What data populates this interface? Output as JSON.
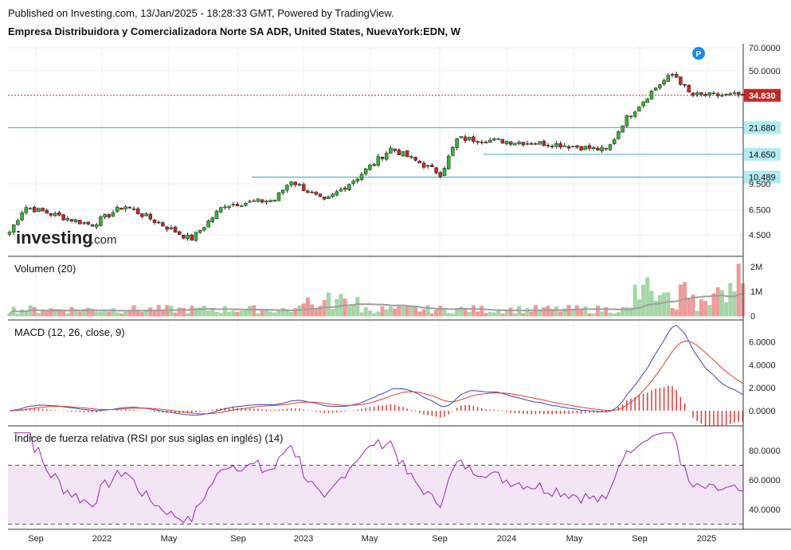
{
  "header": {
    "published": "Published on Investing.com, 13/Jan/2025 - 18:28:33 GMT, Powered by TradingView.",
    "instrument": "Empresa Distribuidora y Comercializadora Norte SA ADR, United States, NuevaYork:EDN, W"
  },
  "logo": {
    "text": "investing",
    "suffix": ".com"
  },
  "colors": {
    "up": "#3ab03a",
    "down": "#c62828",
    "ma": "#9e9e9e",
    "macd": "#3949ab",
    "signal": "#e53935",
    "rsi": "#9c27b0",
    "rsi_band": "#f3e5f5",
    "level": "#4aa3b5",
    "price_line": "#c62828"
  },
  "chart_data": [
    {
      "type": "candlestick",
      "title": "",
      "price_scale": "log",
      "y_ticks": [
        "70.0000",
        "50.0000",
        "21.680",
        "14.650",
        "10.489",
        "9.500",
        "6.500",
        "4.500"
      ],
      "x_ticks": [
        "Sep",
        "2022",
        "May",
        "Sep",
        "2023",
        "May",
        "Sep",
        "2024",
        "May",
        "Sep",
        "2025"
      ],
      "last_price_label": "34.830",
      "levels": [
        {
          "label": "21.680",
          "value": 21.68
        },
        {
          "label": "14.650",
          "value": 14.65
        },
        {
          "label": "10.489",
          "value": 10.489
        }
      ],
      "marker": "P",
      "ohlc_anchors": [
        {
          "date": "2021-08",
          "close": 4.5
        },
        {
          "date": "2021-09",
          "close": 6.8
        },
        {
          "date": "2022-01",
          "close": 5.2
        },
        {
          "date": "2022-03",
          "close": 6.9
        },
        {
          "date": "2022-07",
          "close": 4.2
        },
        {
          "date": "2022-09",
          "close": 7.0
        },
        {
          "date": "2022-12",
          "close": 7.5
        },
        {
          "date": "2023-01",
          "close": 10.0
        },
        {
          "date": "2023-03",
          "close": 7.3
        },
        {
          "date": "2023-05",
          "close": 10.5
        },
        {
          "date": "2023-07",
          "close": 16.0
        },
        {
          "date": "2023-09",
          "close": 12.5
        },
        {
          "date": "2023-10",
          "close": 11.0
        },
        {
          "date": "2023-11",
          "close": 18.5
        },
        {
          "date": "2024-05",
          "close": 17.0
        },
        {
          "date": "2024-08",
          "close": 15.5
        },
        {
          "date": "2024-09",
          "close": 24.0
        },
        {
          "date": "2024-11",
          "close": 40.0
        },
        {
          "date": "2024-12",
          "close": 48.0
        },
        {
          "date": "2025-01",
          "close": 34.83
        }
      ]
    },
    {
      "type": "bar",
      "title": "Volumen (20)",
      "y_ticks": [
        "2M",
        "1M",
        "0"
      ]
    },
    {
      "type": "line",
      "title": "MACD (12, 26, close, 9)",
      "y_ticks": [
        "6.0000",
        "4.0000",
        "2.0000",
        "0.0000"
      ],
      "series": [
        {
          "values_peak": 6.8
        },
        {
          "values_peak": 5.9
        }
      ]
    },
    {
      "type": "line",
      "title": "Índice de fuerza relativa (RSI por sus siglas en inglés) (14)",
      "y_ticks": [
        "80.0000",
        "60.0000",
        "40.0000"
      ],
      "bands": [
        70,
        30
      ]
    }
  ]
}
